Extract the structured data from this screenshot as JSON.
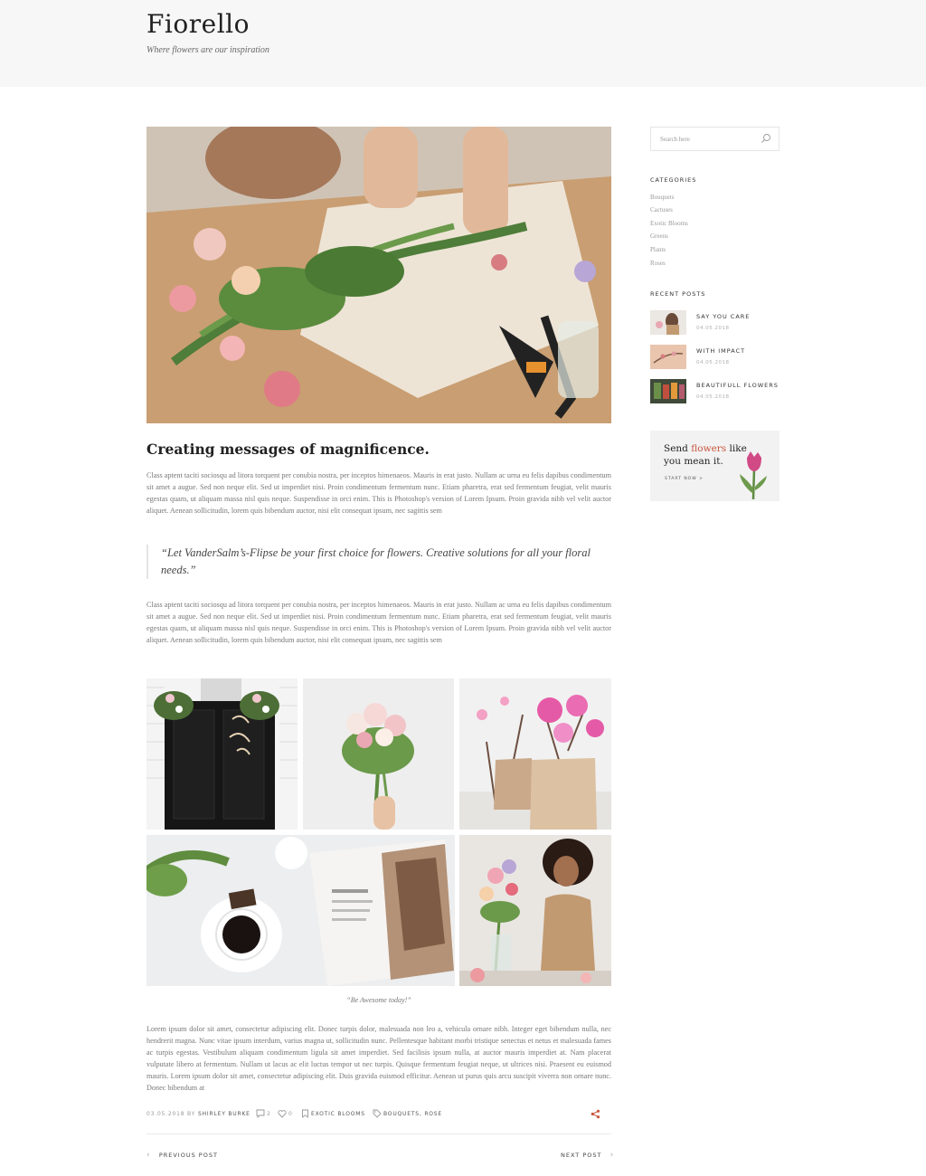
{
  "site": {
    "title": "Fiorello",
    "tagline": "Where flowers are our inspiration"
  },
  "post": {
    "title": "Creating messages of magnificence.",
    "paragraph1": "Class aptent taciti sociosqu ad litora torquent per conubia nostra, per inceptos himenaeos. Mauris in erat justo. Nullam ac urna eu felis dapibus condimentum sit amet a augue. Sed non neque elit. Sed ut imperdiet nisi. Proin condimentum fermentum nunc. Etiam pharetra, erat sed fermentum feugiat, velit mauris egestas quam, ut aliquam massa nisl quis neque. Suspendisse in orci enim. This is Photoshop's version of Lorem Ipsum. Proin gravida nibh vel velit auctor aliquet. Aenean sollicitudin, lorem quis bibendum auctor, nisi elit consequat ipsum, nec sagittis sem",
    "quote": "“Let VanderSalm’s-Flipse be your first choice for flowers. Creative solutions for all your floral needs.”",
    "paragraph2": "Class aptent taciti sociosqu ad litora torquent per conubia nostra, per inceptos himenaeos. Mauris in erat justo. Nullam ac urna eu felis dapibus condimentum sit amet a augue. Sed non neque elit. Sed ut imperdiet nisi. Proin condimentum fermentum nunc. Etiam pharetra, erat sed fermentum feugiat, velit mauris egestas quam, ut aliquam massa nisl quis neque. Suspendisse in orci enim. This is Photoshop's version of Lorem Ipsum. Proin gravida nibh vel velit auctor aliquet. Aenean sollicitudin, lorem quis bibendum auctor, nisi elit consequat ipsum, nec sagittis sem",
    "gallery_caption": "“Be Awesome today!”",
    "paragraph3": "Lorem ipsum dolor sit amet, consectetur adipiscing elit. Donec turpis dolor, malesuada non leo a, vehicula ornare nibh. Integer eget bibendum nulla, nec hendrerit magna. Nunc vitae ipsum interdum, varius magna ut, sollicitudin nunc. Pellentesque habitant morbi tristique senectus et netus et malesuada fames ac turpis egestas. Vestibulum aliquam condimentum ligula sit amet imperdiet. Sed facilisis ipsum nulla, at auctor mauris imperdiet at. Nam placerat vulputate libero at fermentum. Nullam ut lacus ac elit luctus tempor ut nec turpis. Quisque fermentum feugiat neque, ut ultrices nisi. Praesent eu euismod mauris. Lorem ipsum dolor sit amet, consectetur adipiscing elit. Duis gravida euismod efficitur. Aenean ut purus quis arcu suscipit viverra non ornare nunc. Donec bibendum at",
    "meta": {
      "date": "03.05.2018",
      "by": "BY",
      "author": "SHIRLEY BURKE",
      "comments": "2",
      "likes": "0",
      "category": "EXOTIC BLOOMS",
      "tags": "BOUQUETS, ROSE"
    },
    "nav": {
      "previous": "PREVIOUS POST",
      "next": "NEXT POST"
    }
  },
  "sidebar": {
    "search_placeholder": "Search here",
    "categories_title": "CATEGORIES",
    "categories": [
      "Bouquets",
      "Cactuses",
      "Exotic Blooms",
      "Greens",
      "Plants",
      "Roses"
    ],
    "recent_title": "RECENT POSTS",
    "recent_posts": [
      {
        "title": "SAY YOU CARE",
        "date": "04.05.2018"
      },
      {
        "title": "WITH IMPACT",
        "date": "04.05.2018"
      },
      {
        "title": "BEAUTIFULL FLOWERS",
        "date": "04.05.2018"
      }
    ],
    "banner": {
      "text_before": "Send",
      "text_accent": "flowers",
      "text_after": "like",
      "line2": "you mean it.",
      "cta": "START NOW >"
    }
  },
  "colors": {
    "accent": "#c8563e",
    "header_bg": "#f7f7f7"
  }
}
